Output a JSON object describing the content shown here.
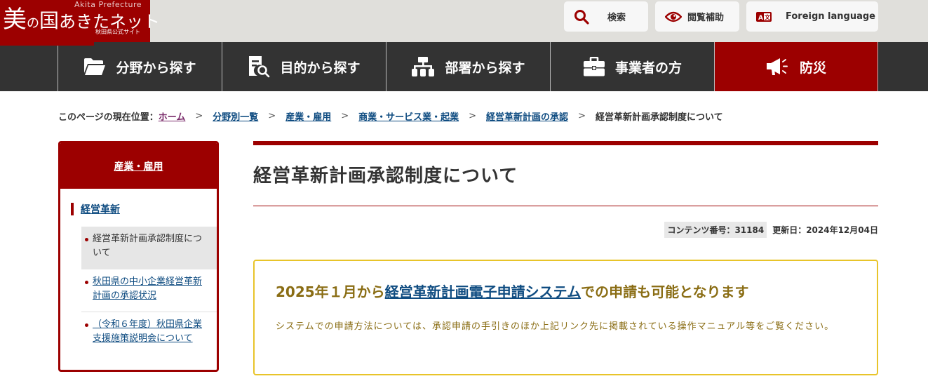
{
  "header": {
    "logo": {
      "english": "Akita Prefecture",
      "title_part1": "美",
      "title_part2": "の",
      "title_part3": "国",
      "title_part4": "あきたネット",
      "subtitle": "秋田県公式サイト"
    },
    "buttons": [
      {
        "label": "検索",
        "icon": "search-icon"
      },
      {
        "label": "閲覧補助",
        "icon": "eye-icon"
      },
      {
        "label": "Foreign language",
        "icon": "translate-icon"
      }
    ]
  },
  "nav": {
    "items": [
      {
        "label": "分野から探す",
        "icon": "folder-icon"
      },
      {
        "label": "目的から探す",
        "icon": "document-search-icon"
      },
      {
        "label": "部署から探す",
        "icon": "org-chart-icon"
      },
      {
        "label": "事業者の方",
        "icon": "briefcase-icon"
      },
      {
        "label": "防災",
        "icon": "megaphone-icon"
      }
    ]
  },
  "breadcrumb": {
    "lead": "このページの現在位置：",
    "items": [
      "ホーム",
      "分野別一覧",
      "産業・雇用",
      "商業・サービス業・起業",
      "経営革新計画の承認"
    ],
    "separator": ">",
    "current": "経営革新計画承認制度について"
  },
  "sidebar": {
    "heading": "産業・雇用",
    "category": "経営革新",
    "items": [
      {
        "label": "経営革新計画承認制度について",
        "active": true
      },
      {
        "label": "秋田県の中小企業経営革新計画の承認状況",
        "active": false
      },
      {
        "label": "（令和６年度）秋田県企業支援施策説明会について",
        "active": false
      }
    ]
  },
  "main": {
    "title": "経営革新計画承認制度について",
    "content_id": "コンテンツ番号：31184",
    "updated": "更新日：2024年12月04日",
    "notice": {
      "heading_prefix": "2025年１月から",
      "heading_link": "経営革新計画電子申請システム",
      "heading_suffix": "での申請も可能となります",
      "body": "システムでの申請方法については、承認申請の手引きのほか上記リンク先に掲載されている操作マニュアル等をご覧ください。"
    }
  },
  "colors": {
    "brand_red": "#9c0000",
    "nav_dark": "#333333",
    "link_blue": "#0f4c81",
    "notice_border": "#e8c42a",
    "notice_text": "#8a6d14",
    "header_bg": "#e0dfdb"
  }
}
